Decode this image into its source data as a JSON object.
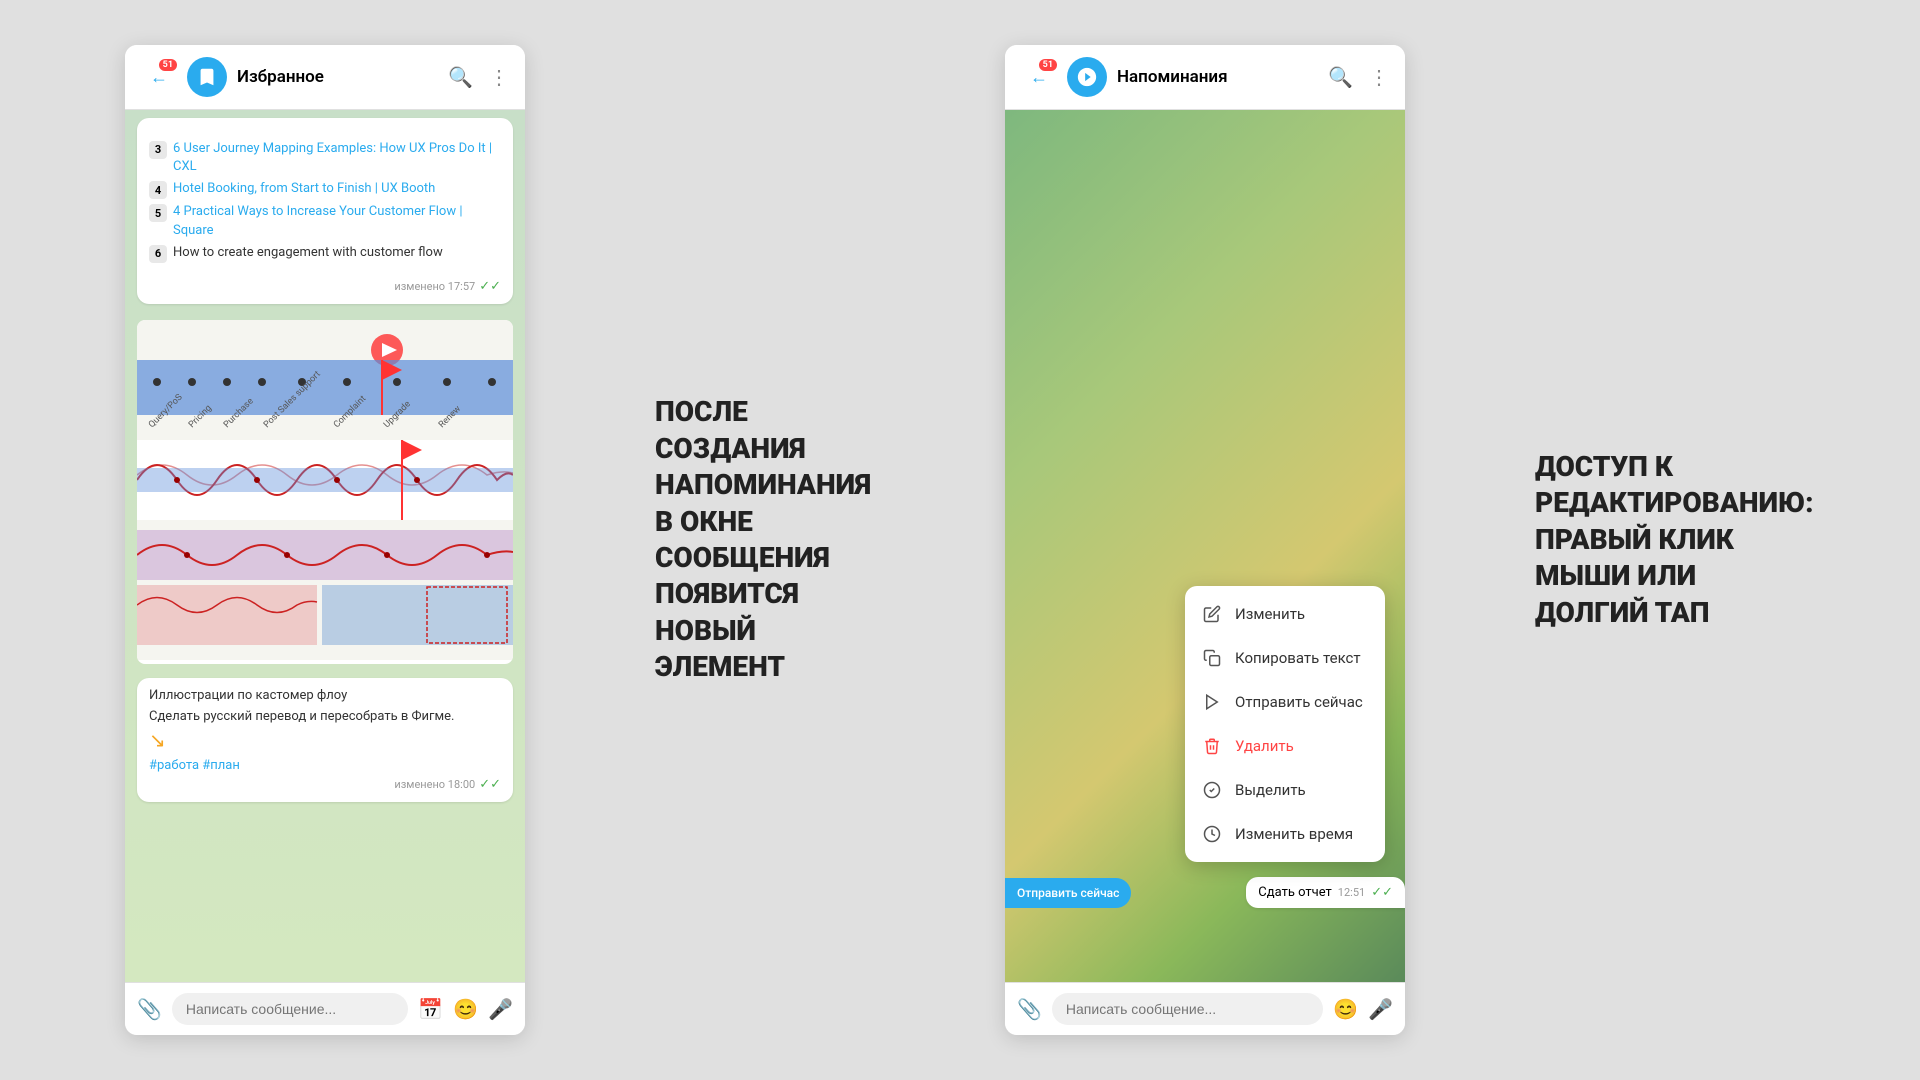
{
  "leftWindow": {
    "title": "Избранное",
    "backBadge": "51",
    "headerIcons": [
      "search",
      "more"
    ],
    "messages": [
      {
        "listItems": [
          {
            "num": "3",
            "text": "6 User Journey Mapping Examples: How UX Pros Do It | CXL"
          },
          {
            "num": "4",
            "text": "Hotel Booking, from Start to Finish | UX Booth"
          },
          {
            "num": "5",
            "text": "4 Practical Ways to Increase Your Customer Flow | Square"
          },
          {
            "num": "6",
            "text": "How to create engagement with customer flow"
          }
        ],
        "time": "изменено 17:57",
        "tick": "✓✓"
      }
    ],
    "caption": {
      "title": "Иллюстрации по кастомер флоу",
      "desc": "Сделать русский перевод и пересобрать в Фигме.",
      "tags": "#работа #план",
      "time": "изменено 18:00",
      "tick": "✓✓"
    },
    "inputPlaceholder": "Написать сообщение...",
    "inputIcons": [
      "attach",
      "calendar",
      "emoji",
      "mic"
    ]
  },
  "middleAnnotation": {
    "text": "ПОСЛЕ СОЗДАНИЯ НАПОМИНАНИЯ В ОКНЕ СООБЩЕНИЯ ПОЯВИТСЯ НОВЫЙ ЭЛЕМЕНТ"
  },
  "rightWindow": {
    "title": "Напоминания",
    "backBadge": "51",
    "contextMenu": {
      "items": [
        {
          "icon": "✏️",
          "label": "Изменить",
          "type": "edit"
        },
        {
          "icon": "📋",
          "label": "Копировать текст",
          "type": "copy"
        },
        {
          "icon": "▷",
          "label": "Отправить сейчас",
          "type": "send-now"
        },
        {
          "icon": "🗑️",
          "label": "Удалить",
          "type": "delete"
        },
        {
          "icon": "✓",
          "label": "Выделить",
          "type": "select"
        },
        {
          "icon": "🕐",
          "label": "Изменить время",
          "type": "edit-time"
        }
      ]
    },
    "reportBubble": {
      "text": "Сдать отчет",
      "time": "12:51",
      "tick": "✓✓"
    },
    "sendPartial": "Отправить сейчас",
    "inputPlaceholder": "Написать сообщение...",
    "inputIcons": [
      "attach",
      "emoji",
      "mic"
    ]
  },
  "rightAnnotation": {
    "text": "ДОСТУП К РЕДАКТИРОВАНИЮ: ПРАВЫЙ КЛИК МЫШИ ИЛИ ДОЛГИЙ ТАП"
  }
}
